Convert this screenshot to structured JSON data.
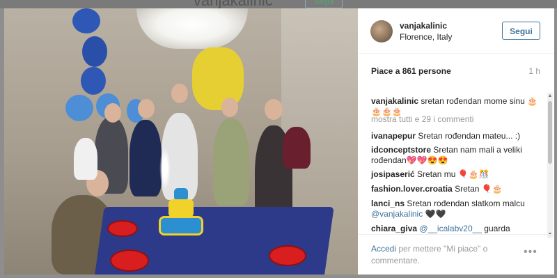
{
  "background_header": {
    "ghost_title": "vanjakalinic",
    "ghost_follow": "Segui"
  },
  "post": {
    "username": "vanjakalinic",
    "location": "Florence, Italy",
    "follow_label": "Segui",
    "likes": "Piace a 861 persone",
    "time": "1 h",
    "caption": {
      "user": "vanjakalinic",
      "text": "sretan rođendan mome sinu 🎂🎂🎂🎂"
    },
    "view_more": "mostra tutti e 29 i commenti",
    "comments": [
      {
        "user": "ivanapepur",
        "text": "Sretan rođendan mateu... :)"
      },
      {
        "user": "idconceptstore",
        "text": "Sretan nam mali a veliki rođendan💖💖😍😍"
      },
      {
        "user": "josipaserić",
        "text": "Sretan mu 🎈🎂🎊"
      },
      {
        "user": "fashion.lover.croatia",
        "text": "Sretan 🎈🎂"
      },
      {
        "user": "lanci_ns",
        "text": "Sretan rođendan slatkom malcu",
        "mention": "@vanjakalinic",
        "after": " 🖤🖤"
      },
      {
        "user": "chiara_giva",
        "text": "",
        "mention": "@__icalabv20__",
        "after": " guarda"
      }
    ],
    "footer": {
      "accedi": "Accedi",
      "rest": "per mettere \"Mi piace\" o commentare.",
      "more_icon": "•••"
    }
  },
  "colors": {
    "link": "#3f729b",
    "follow_border": "#3f729b",
    "muted": "#999999"
  }
}
